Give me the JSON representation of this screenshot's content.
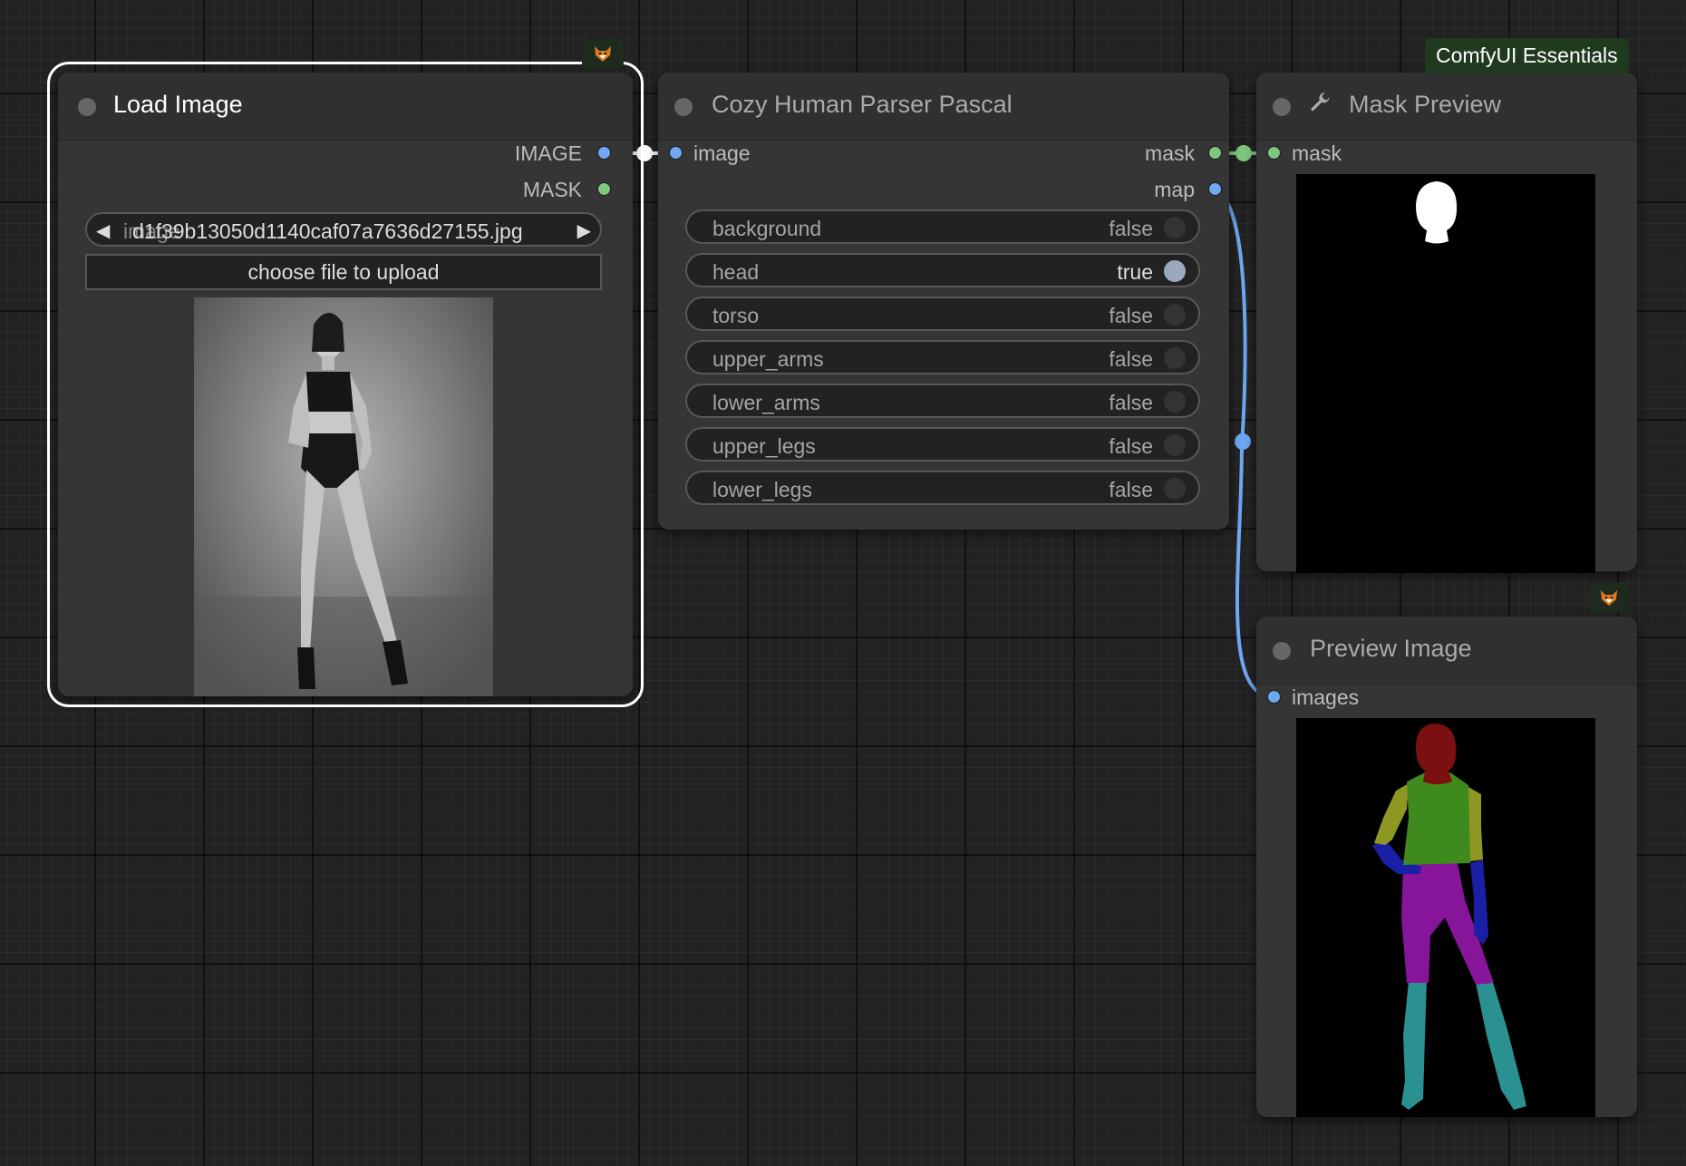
{
  "load_image_node": {
    "title": "Load Image",
    "outputs": [
      "IMAGE",
      "MASK"
    ],
    "combo": {
      "name": "image",
      "value": "d1f39b13050d1140caf07a7636d27155.jpg"
    },
    "upload_label": "choose file to upload"
  },
  "parser_node": {
    "title": "Cozy Human Parser Pascal",
    "input": "image",
    "outputs": [
      "mask",
      "map"
    ],
    "toggles": [
      {
        "label": "background",
        "value": "false"
      },
      {
        "label": "head",
        "value": "true"
      },
      {
        "label": "torso",
        "value": "false"
      },
      {
        "label": "upper_arms",
        "value": "false"
      },
      {
        "label": "lower_arms",
        "value": "false"
      },
      {
        "label": "upper_legs",
        "value": "false"
      },
      {
        "label": "lower_legs",
        "value": "false"
      }
    ]
  },
  "mask_preview_node": {
    "title": "Mask Preview",
    "input": "mask"
  },
  "preview_image_node": {
    "title": "Preview Image",
    "input": "images"
  },
  "badge": "ComfyUI Essentials",
  "colors": {
    "image_slot": "#6fa8f3",
    "mask_slot": "#7fc77f",
    "head": "#7b1010",
    "torso": "#3f8a1c",
    "upper_arms": "#8e9624",
    "lower_arms": "#1a20a6",
    "upper_legs": "#86159a",
    "lower_legs": "#2b9090"
  },
  "icons": [
    "fox-icon",
    "wrench-icon",
    "arrow-left-icon",
    "arrow-right-icon"
  ]
}
